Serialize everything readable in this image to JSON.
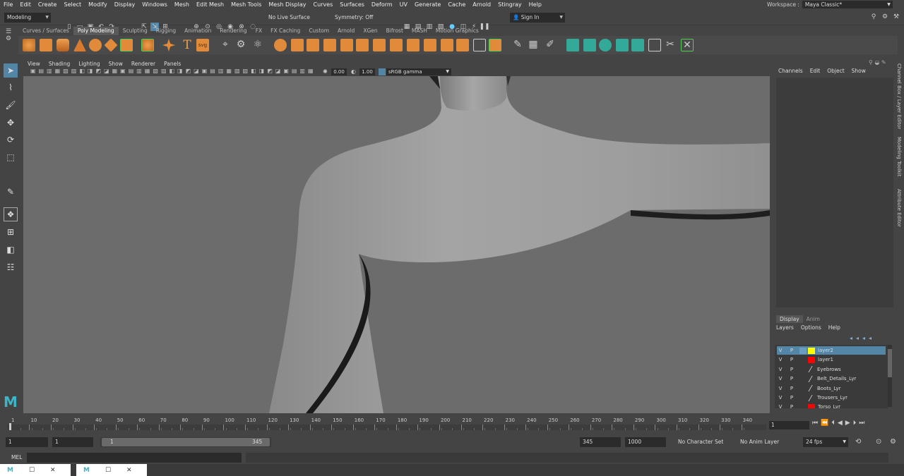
{
  "menubar": [
    "File",
    "Edit",
    "Create",
    "Select",
    "Modify",
    "Display",
    "Windows",
    "Mesh",
    "Edit Mesh",
    "Mesh Tools",
    "Mesh Display",
    "Curves",
    "Surfaces",
    "Deform",
    "UV",
    "Generate",
    "Cache",
    "Arnold",
    "Stingray",
    "Help"
  ],
  "workspace": {
    "label": "Workspace :",
    "value": "Maya Classic*"
  },
  "status": {
    "menuset": "Modeling",
    "live_surface": "No Live Surface",
    "symmetry": "Symmetry: Off",
    "sign_in": "Sign In"
  },
  "shelf_tabs": [
    "Curves / Surfaces",
    "Poly Modeling",
    "Sculpting",
    "Rigging",
    "Animation",
    "Rendering",
    "FX",
    "FX Caching",
    "Custom",
    "Arnold",
    "XGen",
    "Bifrost",
    "MASH",
    "Motion Graphics"
  ],
  "shelf_active": "Poly Modeling",
  "shelf_svg_label": "svg",
  "shelf_text_label": "T",
  "panel_menu": [
    "View",
    "Shading",
    "Lighting",
    "Show",
    "Renderer",
    "Panels"
  ],
  "panel_tools": {
    "exposure": "0.00",
    "gamma": "1.00",
    "color_space": "sRGB gamma"
  },
  "channel_box": {
    "menu": [
      "Channels",
      "Edit",
      "Object",
      "Show"
    ]
  },
  "layer_editor": {
    "tabs": [
      "Display",
      "Anim"
    ],
    "menu": [
      "Layers",
      "Options",
      "Help"
    ],
    "layers": [
      {
        "v": "V",
        "p": "P",
        "color": "#ffff00",
        "name": "layer2",
        "selected": true
      },
      {
        "v": "V",
        "p": "P",
        "color": "#ff0000",
        "name": "layer1",
        "selected": false
      },
      {
        "v": "V",
        "p": "P",
        "color": "",
        "name": "Eyebrows",
        "selected": false
      },
      {
        "v": "V",
        "p": "P",
        "color": "",
        "name": "Belt_Details_Lyr",
        "selected": false
      },
      {
        "v": "V",
        "p": "P",
        "color": "",
        "name": "Boots_Lyr",
        "selected": false
      },
      {
        "v": "V",
        "p": "P",
        "color": "",
        "name": "Trousers_Lyr",
        "selected": false
      },
      {
        "v": "V",
        "p": "P",
        "color": "#ff0000",
        "name": "Torso_Lyr",
        "selected": false
      }
    ]
  },
  "side_tabs": [
    "Channel Box / Layer Editor",
    "Modeling Toolkit",
    "Attribute Editor"
  ],
  "timeline": {
    "ticks": [
      "1",
      "10",
      "20",
      "30",
      "40",
      "50",
      "60",
      "70",
      "80",
      "90",
      "100",
      "110",
      "120",
      "130",
      "140",
      "150",
      "160",
      "170",
      "180",
      "190",
      "200",
      "210",
      "220",
      "230",
      "240",
      "250",
      "260",
      "270",
      "280",
      "290",
      "300",
      "310",
      "320",
      "330",
      "340"
    ],
    "current_frame": "1"
  },
  "range": {
    "start": "1",
    "playback_start": "1",
    "slider_start": "1",
    "slider_end": "345",
    "playback_end": "345",
    "end": "1000",
    "character_set": "No Character Set",
    "anim_layer": "No Anim Layer",
    "fps": "24 fps"
  },
  "cmdline": {
    "label": "MEL"
  },
  "logo": "M"
}
